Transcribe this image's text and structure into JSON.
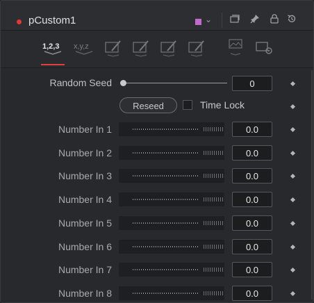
{
  "header": {
    "title": "pCustom1",
    "dot_color": "#e53735",
    "node_color": "#c06ad0",
    "icons": [
      "color-dropdown-chevron-icon",
      "version-icon",
      "pin-icon",
      "lock-icon",
      "reset-icon"
    ]
  },
  "tabs": [
    {
      "label": "1,2,3",
      "active": true
    },
    {
      "label": "x,y,z",
      "active": false
    },
    {
      "label": "",
      "icon": "script-tab-icon-1"
    },
    {
      "label": "",
      "icon": "script-tab-icon-2"
    },
    {
      "label": "",
      "icon": "script-tab-icon-3"
    },
    {
      "label": "",
      "icon": "script-tab-icon-4"
    },
    {
      "label": "",
      "icon": "image-tab-icon"
    },
    {
      "label": "",
      "icon": "settings-tab-icon"
    }
  ],
  "random_seed": {
    "label": "Random Seed",
    "value": "0"
  },
  "reseed": {
    "label": "Reseed"
  },
  "time_lock": {
    "label": "Time Lock",
    "checked": false
  },
  "numbers": [
    {
      "label": "Number In 1",
      "value": "0.0"
    },
    {
      "label": "Number In 2",
      "value": "0.0"
    },
    {
      "label": "Number In 3",
      "value": "0.0"
    },
    {
      "label": "Number In 4",
      "value": "0.0"
    },
    {
      "label": "Number In 5",
      "value": "0.0"
    },
    {
      "label": "Number In 6",
      "value": "0.0"
    },
    {
      "label": "Number In 7",
      "value": "0.0"
    },
    {
      "label": "Number In 8",
      "value": "0.0"
    }
  ]
}
